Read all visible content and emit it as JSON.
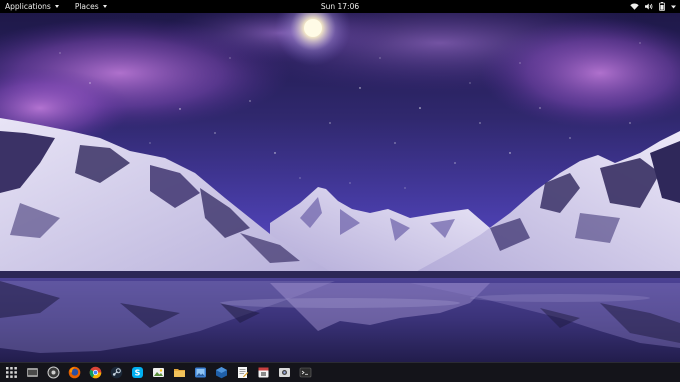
{
  "topbar": {
    "applications_label": "Applications",
    "places_label": "Places",
    "clock": "Sun 17:06",
    "status_icons": [
      "wifi-icon",
      "volume-icon",
      "battery-icon",
      "power-menu-arrow-icon"
    ]
  },
  "wallpaper": {
    "description_colors": {
      "sky_top": "#2a1f5c",
      "sky_mid": "#4a3ca8",
      "aurora": "#b46ad6",
      "moon": "#fff6d8",
      "snow": "#d7d2ec",
      "lake": "#2d2a55"
    }
  },
  "dock": {
    "items": [
      "app-grid-icon",
      "files-icon",
      "settings-icon",
      "firefox-icon",
      "chrome-icon",
      "steam-icon",
      "skype-icon",
      "image-viewer-icon",
      "file-manager-icon",
      "photos-icon",
      "virtualbox-icon",
      "text-editor-icon",
      "calendar-icon",
      "screenshot-icon",
      "terminal-icon"
    ]
  },
  "colors": {
    "topbar_bg": "#000000",
    "topbar_text": "#eeeeec",
    "dock_bg": "#14141a"
  }
}
